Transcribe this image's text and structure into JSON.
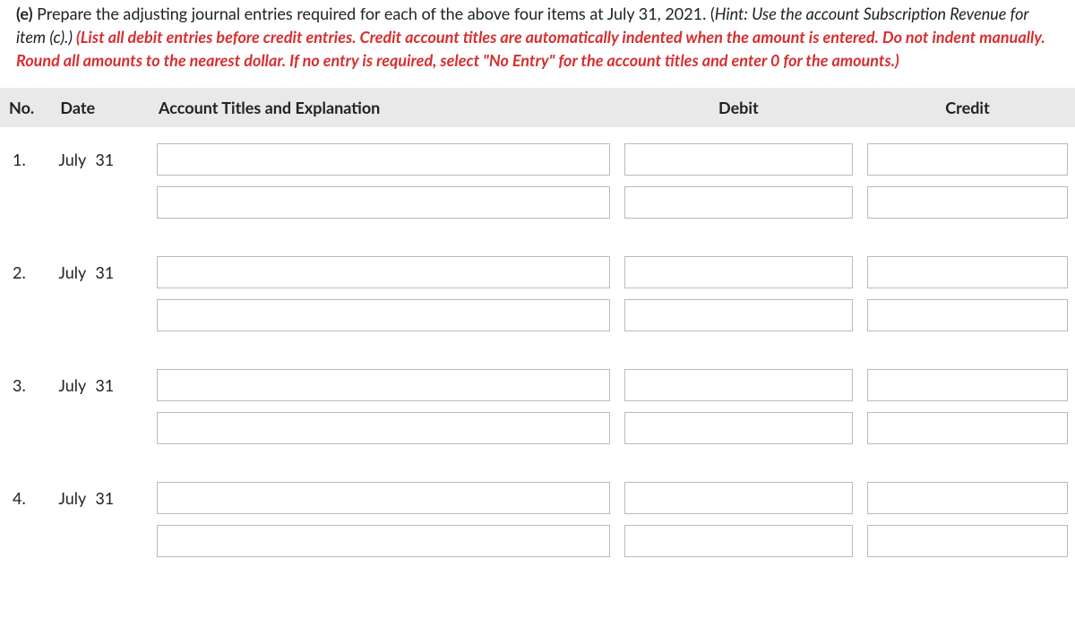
{
  "instructions": {
    "part_label": "(e)",
    "main": "Prepare the adjusting journal entries required for each of the above four items at July 31, 2021. (",
    "hint_label": "Hint:",
    "hint_text": " Use the account Subscription Revenue for item (c).)",
    "red": " (List all debit entries before credit entries. Credit account titles are automatically indented when the amount is entered. Do not indent manually. Round all amounts to the nearest dollar. If no entry is required, select \"No Entry\" for the account titles and enter 0 for the amounts.)"
  },
  "headers": {
    "no": "No.",
    "date": "Date",
    "account": "Account Titles and Explanation",
    "debit": "Debit",
    "credit": "Credit"
  },
  "entries": [
    {
      "no": "1.",
      "month": "July",
      "day": "31"
    },
    {
      "no": "2.",
      "month": "July",
      "day": "31"
    },
    {
      "no": "3.",
      "month": "July",
      "day": "31"
    },
    {
      "no": "4.",
      "month": "July",
      "day": "31"
    }
  ]
}
